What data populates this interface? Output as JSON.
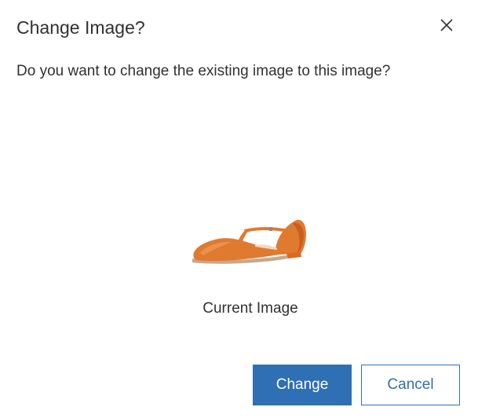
{
  "dialog": {
    "title": "Change Image?",
    "message": "Do you want to change the existing image to this image?",
    "image_caption": "Current Image",
    "close_icon": "close-icon",
    "image": "orange-shoe-product-image",
    "buttons": {
      "primary_label": "Change",
      "secondary_label": "Cancel"
    }
  },
  "colors": {
    "primary": "#2f6fb3",
    "text": "#323130",
    "shoe": "#e07a2e"
  }
}
